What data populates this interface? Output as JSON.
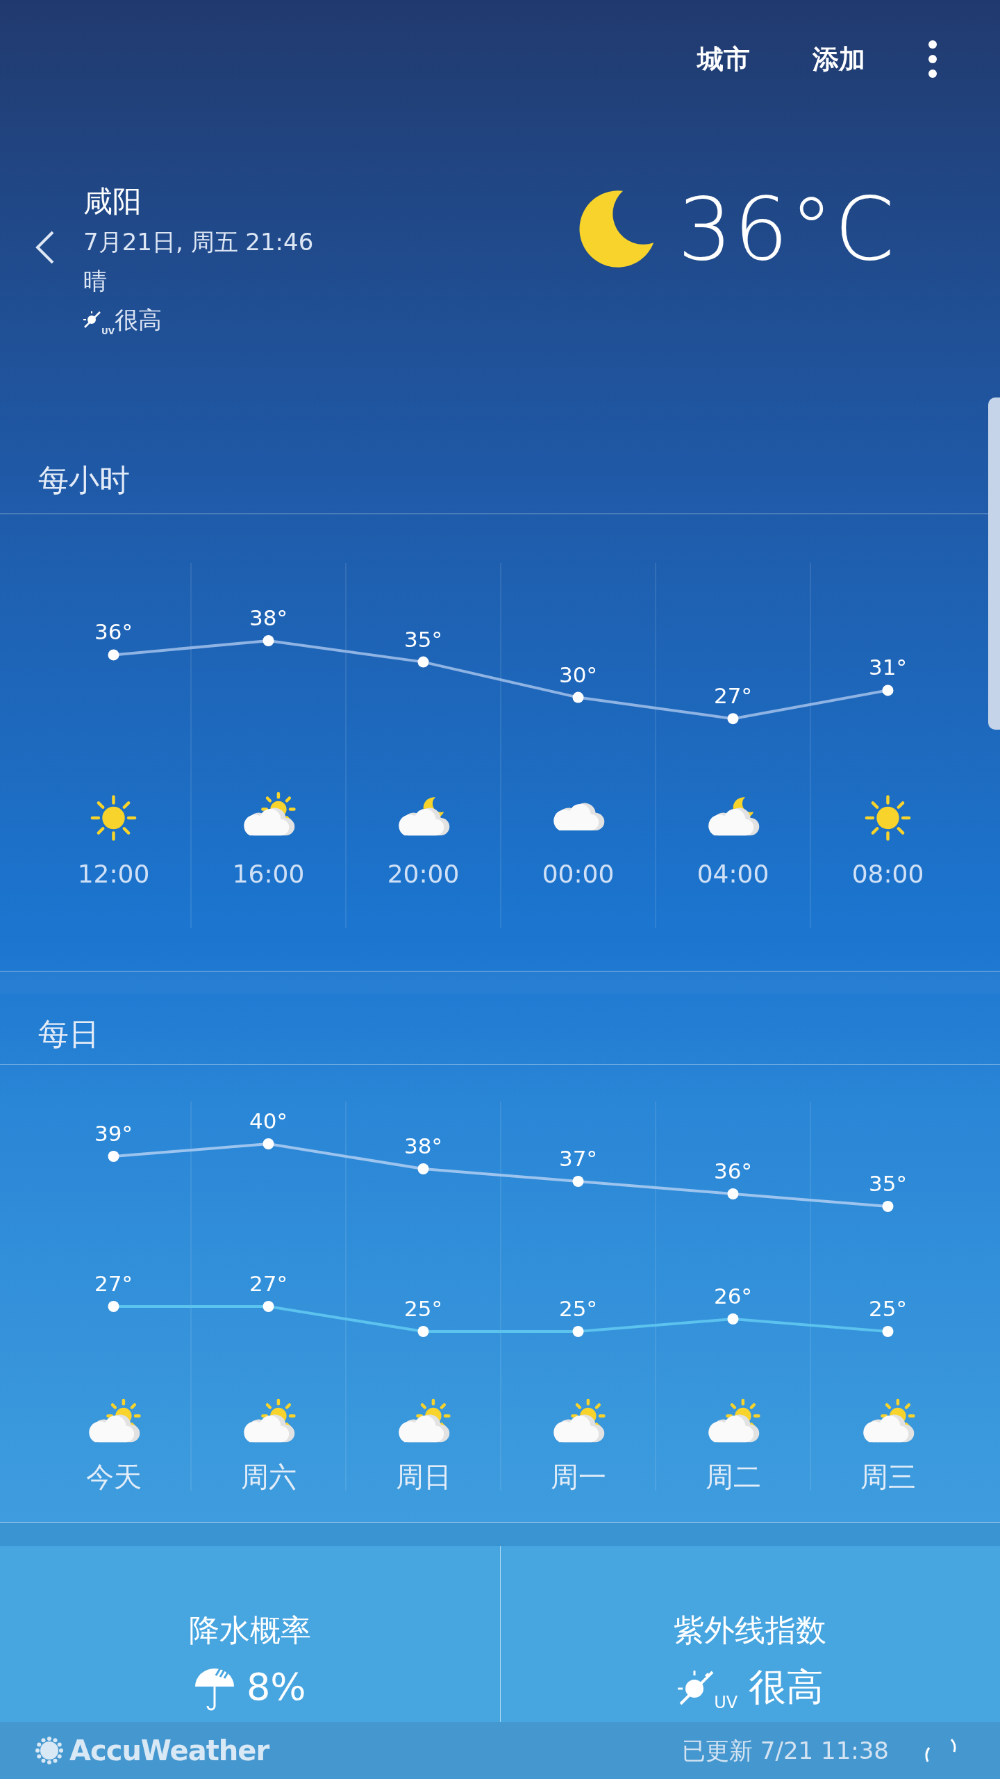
{
  "top_bar": {
    "actions": [
      "城市",
      "添加"
    ]
  },
  "current": {
    "city": "咸阳",
    "datetime": "7月21日, 周五 21:46",
    "condition": "晴",
    "uv_badge": "UV",
    "uv_text": "很高",
    "kind": "moon",
    "temperature": "36°C"
  },
  "hourly": {
    "title": "每小时",
    "chart_data": {
      "type": "line",
      "categories": [
        "12:00",
        "16:00",
        "20:00",
        "00:00",
        "04:00",
        "08:00"
      ],
      "series": [
        {
          "color": "#8fb4e4",
          "marker": "circle",
          "values": [
            36,
            38,
            35,
            30,
            27,
            31
          ],
          "value_labels": [
            "36°",
            "38°",
            "35°",
            "30°",
            "27°",
            "31°"
          ]
        }
      ]
    },
    "conditions": [
      {
        "kind": "sun"
      },
      {
        "kind": "partly-sunny"
      },
      {
        "kind": "cloud-moon"
      },
      {
        "kind": "cloud"
      },
      {
        "kind": "cloud-moon"
      },
      {
        "kind": "sun"
      }
    ]
  },
  "daily": {
    "title": "每日",
    "chart_data": {
      "type": "line",
      "categories": [
        "今天",
        "周六",
        "周日",
        "周一",
        "周二",
        "周三"
      ],
      "series": [
        {
          "color": "#9cc4ee",
          "marker": "circle",
          "values": [
            39,
            40,
            38,
            37,
            36,
            35
          ],
          "value_labels": [
            "39°",
            "40°",
            "38°",
            "37°",
            "36°",
            "35°"
          ]
        },
        {
          "color": "#5cc2ee",
          "marker": "circle",
          "values": [
            27,
            27,
            25,
            25,
            26,
            25
          ],
          "value_labels": [
            "27°",
            "27°",
            "25°",
            "25°",
            "26°",
            "25°"
          ]
        }
      ]
    },
    "conditions": [
      {
        "kind": "partly-sunny"
      },
      {
        "kind": "partly-sunny"
      },
      {
        "kind": "partly-sunny"
      },
      {
        "kind": "partly-sunny"
      },
      {
        "kind": "partly-sunny"
      },
      {
        "kind": "partly-sunny"
      }
    ]
  },
  "details": [
    {
      "kind": "precipitation",
      "title": "降水概率",
      "value": "8%"
    },
    {
      "kind": "uv",
      "title": "紫外线指数",
      "badge": "UV",
      "value": "很高"
    }
  ],
  "footer": {
    "brand": "AccuWeather",
    "updated": "已更新 7/21 11:38"
  }
}
